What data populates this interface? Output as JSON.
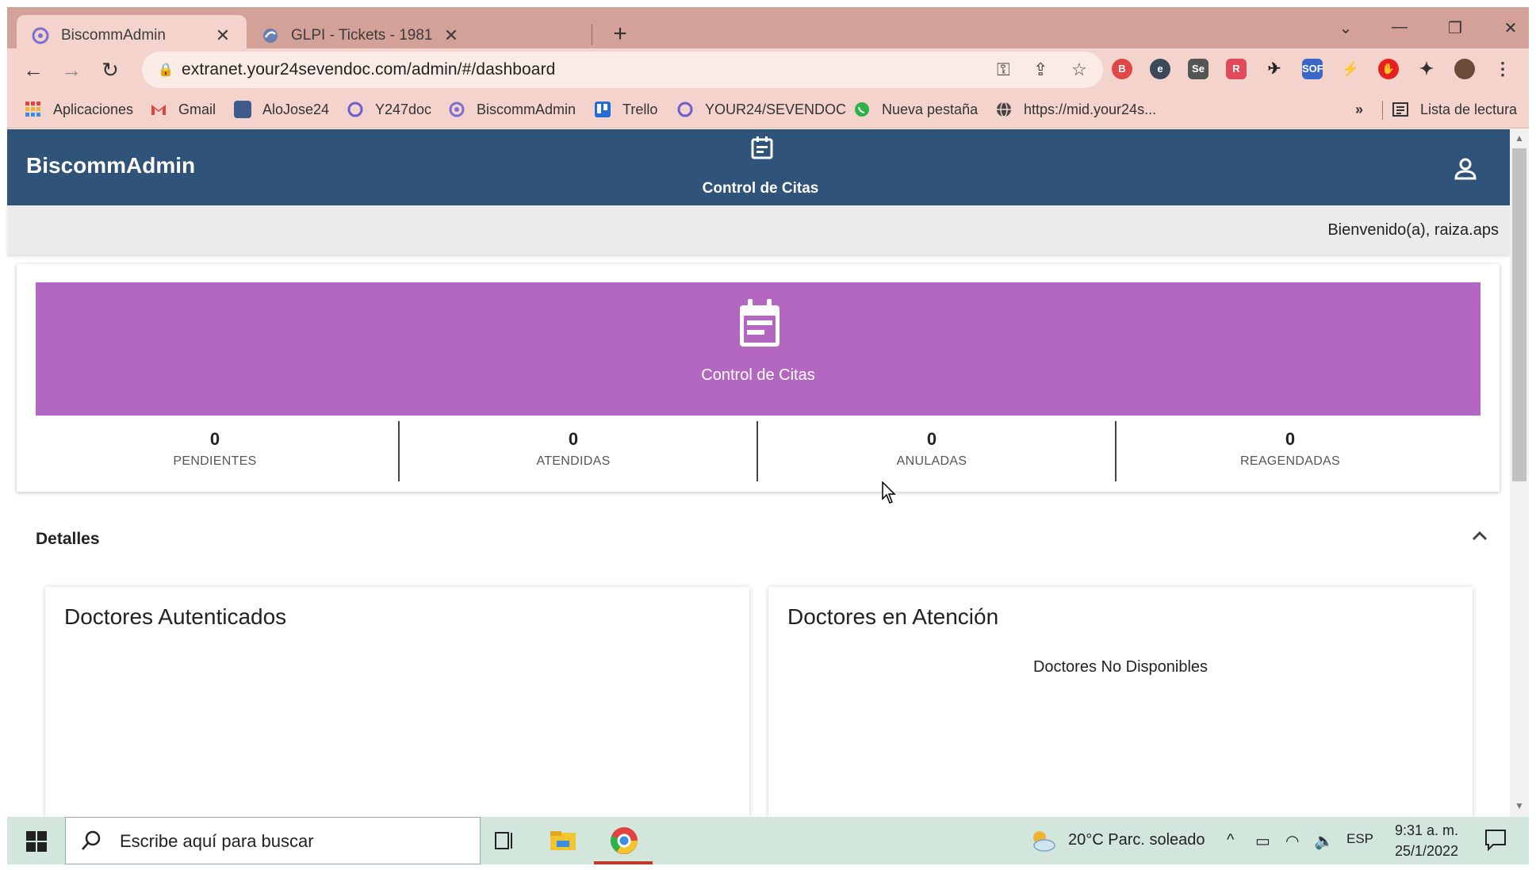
{
  "browser": {
    "tabs": [
      {
        "title": "BiscommAdmin",
        "active": true,
        "icon": "biscomm-icon"
      },
      {
        "title": "GLPI - Tickets - 1981",
        "active": false,
        "icon": "glpi-icon"
      }
    ],
    "url": "extranet.your24sevendoc.com/admin/#/dashboard",
    "bookmarks": [
      {
        "label": "Aplicaciones",
        "icon": "apps-grid-icon"
      },
      {
        "label": "Gmail",
        "icon": "gmail-icon"
      },
      {
        "label": "AloJose24",
        "icon": "alojose-icon"
      },
      {
        "label": "Y247doc",
        "icon": "y247doc-icon"
      },
      {
        "label": "BiscommAdmin",
        "icon": "biscomm-icon"
      },
      {
        "label": "Trello",
        "icon": "trello-icon"
      },
      {
        "label": "YOUR24/SEVENDOC",
        "icon": "your24-icon"
      },
      {
        "label": "Nueva pestaña",
        "icon": "whatsapp-icon"
      },
      {
        "label": "https://mid.your24s...",
        "icon": "globe-icon"
      }
    ],
    "more_bookmarks": "»",
    "reading_list": "Lista de lectura"
  },
  "app": {
    "brand": "BiscommAdmin",
    "nav_label": "Control de Citas",
    "welcome": "Bienvenido(a), raiza.aps",
    "banner_label": "Control de Citas",
    "stats": [
      {
        "value": "0",
        "label": "PENDIENTES"
      },
      {
        "value": "0",
        "label": "ATENDIDAS"
      },
      {
        "value": "0",
        "label": "ANULADAS"
      },
      {
        "value": "0",
        "label": "REAGENDADAS"
      }
    ],
    "section_title": "Detalles",
    "panels": [
      {
        "title": "Doctores Autenticados",
        "message": ""
      },
      {
        "title": "Doctores en Atención",
        "message": "Doctores No Disponibles"
      }
    ]
  },
  "taskbar": {
    "search_placeholder": "Escribe aquí para buscar",
    "weather": "20°C  Parc. soleado",
    "language": "ESP",
    "time": "9:31 a. m.",
    "date": "25/1/2022"
  },
  "colors": {
    "appbar": "#2f5379",
    "banner": "#b467c1",
    "tabstrip": "#d3a197",
    "taskbar": "#d2e6dc"
  }
}
